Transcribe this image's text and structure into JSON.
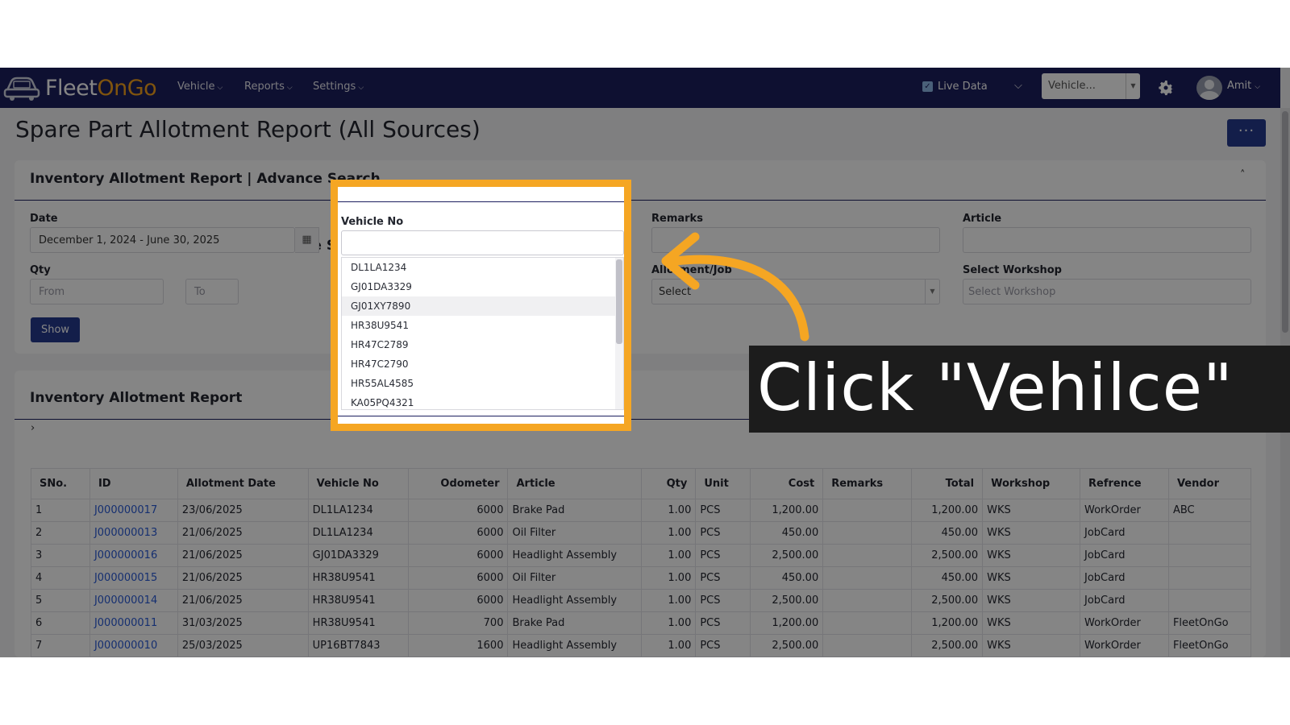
{
  "nav": {
    "logo_a": "Fleet",
    "logo_b": "OnGo",
    "items": [
      {
        "label": "Vehicle"
      },
      {
        "label": "Reports"
      },
      {
        "label": "Settings"
      }
    ],
    "live_data": "Live Data",
    "vehicle_select": "Vehicle...",
    "user": "Amit"
  },
  "page": {
    "title": "Spare Part Allotment Report (All Sources)",
    "more": "···"
  },
  "search": {
    "title": "Inventory Allotment Report | Advance Search",
    "date_label": "Date",
    "date_value": "December 1, 2024 - June 30, 2025",
    "qty_label": "Qty",
    "qty_from_placeholder": "From",
    "qty_to_placeholder": "To",
    "show_label": "Show",
    "remarks_label": "Remarks",
    "article_label": "Article",
    "allotment_label": "Allotment/Job",
    "allotment_value": "Select",
    "workshop_label": "Select Workshop",
    "workshop_placeholder": "Select Workshop"
  },
  "dropdown": {
    "label": "Vehicle No",
    "options": [
      "DL1LA1234",
      "GJ01DA3329",
      "GJ01XY7890",
      "HR38U9541",
      "HR47C2789",
      "HR47C2790",
      "HR55AL4585",
      "KA05PQ4321"
    ]
  },
  "report": {
    "title": "Inventory Allotment Report",
    "expander": "›",
    "columns": [
      "SNo.",
      "ID",
      "Allotment Date",
      "Vehicle No",
      "Odometer",
      "Article",
      "Qty",
      "Unit",
      "Cost",
      "Remarks",
      "Total",
      "Workshop",
      "Refrence",
      "Vendor"
    ],
    "rows": [
      [
        "1",
        "J000000017",
        "23/06/2025",
        "DL1LA1234",
        "6000",
        "Brake Pad",
        "1.00",
        "PCS",
        "1,200.00",
        "",
        "1,200.00",
        "WKS",
        "WorkOrder",
        "ABC"
      ],
      [
        "2",
        "J000000013",
        "21/06/2025",
        "DL1LA1234",
        "6000",
        "Oil Filter",
        "1.00",
        "PCS",
        "450.00",
        "",
        "450.00",
        "WKS",
        "JobCard",
        ""
      ],
      [
        "3",
        "J000000016",
        "21/06/2025",
        "GJ01DA3329",
        "6000",
        "Headlight Assembly",
        "1.00",
        "PCS",
        "2,500.00",
        "",
        "2,500.00",
        "WKS",
        "JobCard",
        ""
      ],
      [
        "4",
        "J000000015",
        "21/06/2025",
        "HR38U9541",
        "6000",
        "Oil Filter",
        "1.00",
        "PCS",
        "450.00",
        "",
        "450.00",
        "WKS",
        "JobCard",
        ""
      ],
      [
        "5",
        "J000000014",
        "21/06/2025",
        "HR38U9541",
        "6000",
        "Headlight Assembly",
        "1.00",
        "PCS",
        "2,500.00",
        "",
        "2,500.00",
        "WKS",
        "JobCard",
        ""
      ],
      [
        "6",
        "J000000011",
        "31/03/2025",
        "HR38U9541",
        "700",
        "Brake Pad",
        "1.00",
        "PCS",
        "1,200.00",
        "",
        "1,200.00",
        "WKS",
        "WorkOrder",
        "FleetOnGo"
      ],
      [
        "7",
        "J000000010",
        "25/03/2025",
        "UP16BT7843",
        "1600",
        "Headlight Assembly",
        "1.00",
        "PCS",
        "2,500.00",
        "",
        "2,500.00",
        "WKS",
        "WorkOrder",
        "FleetOnGo"
      ]
    ]
  },
  "callout": {
    "text": "Click \"Vehilce\""
  },
  "colors": {
    "navbar": "#1c1f5e",
    "accent_orange": "#f5a623",
    "primary_button": "#263a8f",
    "link": "#2a5bd7"
  }
}
